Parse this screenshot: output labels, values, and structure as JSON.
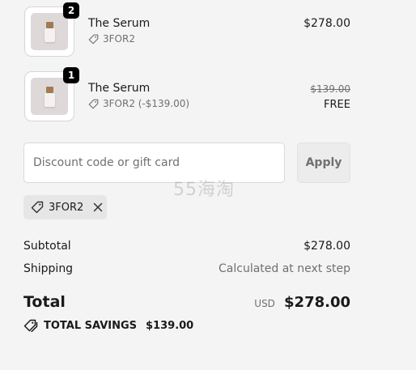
{
  "items": [
    {
      "quantity": "2",
      "name": "The Serum",
      "code": "3FOR2",
      "price": "$278.00",
      "image_icon": "serum-bottle-icon"
    },
    {
      "quantity": "1",
      "name": "The Serum",
      "code": "3FOR2 (-$139.00)",
      "original_price": "$139.00",
      "price": "FREE",
      "image_icon": "serum-bottle-icon"
    }
  ],
  "discount": {
    "placeholder": "Discount code or gift card",
    "value": "",
    "apply_label": "Apply"
  },
  "watermark": "55海淘",
  "applied_code": {
    "label": "3FOR2",
    "icon": "tag-icon",
    "remove_icon": "close-icon"
  },
  "summary": {
    "subtotal_label": "Subtotal",
    "subtotal_value": "$278.00",
    "shipping_label": "Shipping",
    "shipping_value": "Calculated at next step",
    "total_label": "Total",
    "currency": "USD",
    "total_value": "$278.00",
    "savings_label": "TOTAL SAVINGS",
    "savings_value": "$139.00"
  }
}
